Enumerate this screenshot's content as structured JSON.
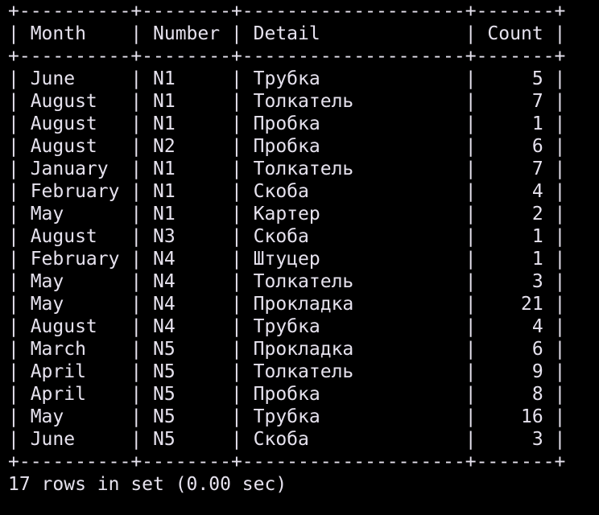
{
  "theme": {
    "background": "#000000",
    "foreground": "#e6e2ee"
  },
  "table": {
    "columns": [
      "Month",
      "Number",
      "Detail",
      "Count"
    ],
    "column_widths": [
      10,
      8,
      20,
      7
    ],
    "count_align": "right",
    "rows": [
      {
        "month": "June",
        "number": "N1",
        "detail": "Трубка",
        "count": "5"
      },
      {
        "month": "August",
        "number": "N1",
        "detail": "Толкатель",
        "count": "7"
      },
      {
        "month": "August",
        "number": "N1",
        "detail": "Пробка",
        "count": "1"
      },
      {
        "month": "August",
        "number": "N2",
        "detail": "Пробка",
        "count": "6"
      },
      {
        "month": "January",
        "number": "N1",
        "detail": "Толкатель",
        "count": "7"
      },
      {
        "month": "February",
        "number": "N1",
        "detail": "Скоба",
        "count": "4"
      },
      {
        "month": "May",
        "number": "N1",
        "detail": "Картер",
        "count": "2"
      },
      {
        "month": "August",
        "number": "N3",
        "detail": "Скоба",
        "count": "1"
      },
      {
        "month": "February",
        "number": "N4",
        "detail": "Штуцер",
        "count": "1"
      },
      {
        "month": "May",
        "number": "N4",
        "detail": "Толкатель",
        "count": "3"
      },
      {
        "month": "May",
        "number": "N4",
        "detail": "Прокладка",
        "count": "21"
      },
      {
        "month": "August",
        "number": "N4",
        "detail": "Трубка",
        "count": "4"
      },
      {
        "month": "March",
        "number": "N5",
        "detail": "Прокладка",
        "count": "6"
      },
      {
        "month": "April",
        "number": "N5",
        "detail": "Толкатель",
        "count": "9"
      },
      {
        "month": "April",
        "number": "N5",
        "detail": "Пробка",
        "count": "8"
      },
      {
        "month": "May",
        "number": "N5",
        "detail": "Трубка",
        "count": "16"
      },
      {
        "month": "June",
        "number": "N5",
        "detail": "Скоба",
        "count": "3"
      }
    ]
  },
  "footer": {
    "summary": "17 rows in set (0.00 sec)"
  }
}
